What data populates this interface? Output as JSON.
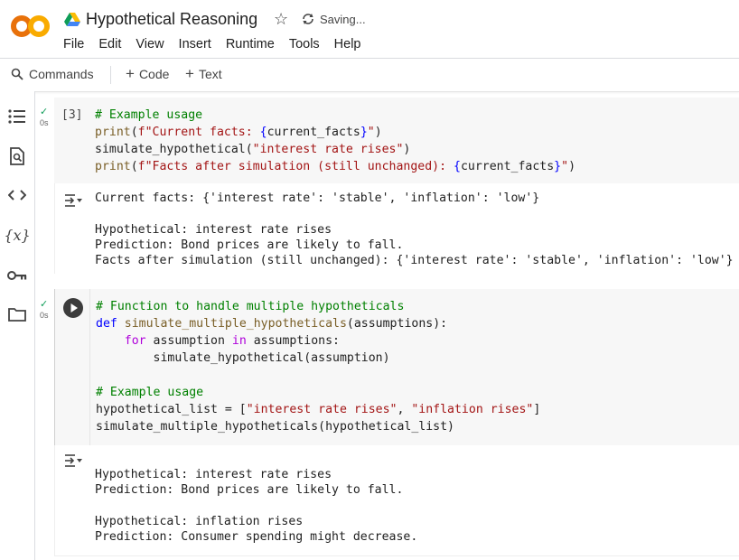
{
  "header": {
    "title": "Hypothetical Reasoning",
    "status": "Saving...",
    "logo_text": "CO"
  },
  "menu": [
    "File",
    "Edit",
    "View",
    "Insert",
    "Runtime",
    "Tools",
    "Help"
  ],
  "toolbar": {
    "commands_label": "Commands",
    "code_label": "Code",
    "text_label": "Text"
  },
  "sidebar": {
    "icons": [
      "table-of-contents-icon",
      "find-icon",
      "code-snippets-icon",
      "variables-icon",
      "secrets-icon",
      "files-icon"
    ],
    "variables_glyph": "{x}"
  },
  "cells": [
    {
      "execution_count": "[3]",
      "exec_time": "0s",
      "code": [
        "# Example usage",
        "print(f\"Current facts: {current_facts}\")",
        "simulate_hypothetical(\"interest rate rises\")",
        "print(f\"Facts after simulation (still unchanged): {current_facts}\")"
      ],
      "output": [
        "Current facts: {'interest rate': 'stable', 'inflation': 'low'}",
        "",
        "Hypothetical: interest rate rises",
        "Prediction: Bond prices are likely to fall.",
        "Facts after simulation (still unchanged): {'interest rate': 'stable', 'inflation': 'low'}"
      ]
    },
    {
      "exec_time": "0s",
      "code": [
        "# Function to handle multiple hypotheticals",
        "def simulate_multiple_hypotheticals(assumptions):",
        "    for assumption in assumptions:",
        "        simulate_hypothetical(assumption)",
        "",
        "# Example usage",
        "hypothetical_list = [\"interest rate rises\", \"inflation rises\"]",
        "simulate_multiple_hypotheticals(hypothetical_list)"
      ],
      "output": [
        "Hypothetical: interest rate rises",
        "Prediction: Bond prices are likely to fall.",
        "",
        "Hypothetical: inflation rises",
        "Prediction: Consumer spending might decrease."
      ]
    }
  ],
  "colors": {
    "comment": "#008000",
    "function": "#795e26",
    "string": "#a31515",
    "keyword": "#af00db",
    "def": "#0000ff",
    "check": "#0f9d58",
    "logo_orange": "#f9ab00",
    "logo_dark": "#e8710a"
  }
}
